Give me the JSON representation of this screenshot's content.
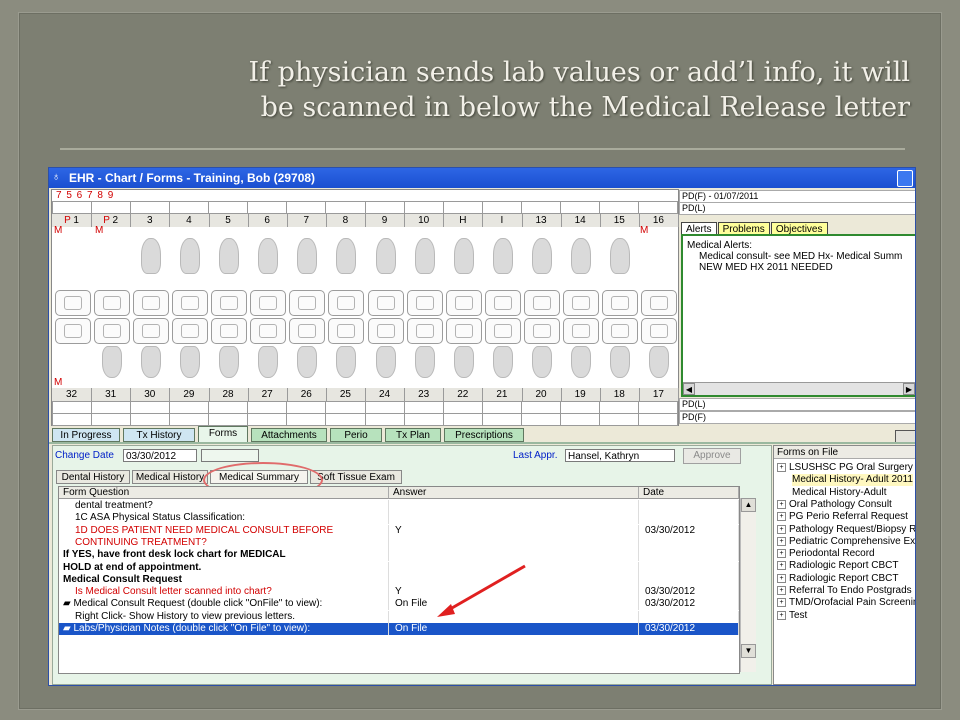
{
  "slide": {
    "title_line1": "If physician sends lab values or add’l info, it will",
    "title_line2": "be scanned in below the Medical Release letter"
  },
  "window": {
    "title": "EHR - Chart / Forms - Training, Bob (29708)",
    "chart": {
      "top_marks": "7 5 6  7 8 9",
      "upper_teeth": [
        {
          "label": "1",
          "prefix": "P"
        },
        {
          "label": "2",
          "prefix": "P"
        },
        {
          "label": "3"
        },
        {
          "label": "4"
        },
        {
          "label": "5"
        },
        {
          "label": "6"
        },
        {
          "label": "7"
        },
        {
          "label": "8"
        },
        {
          "label": "9"
        },
        {
          "label": "10"
        },
        {
          "label": "H"
        },
        {
          "label": "I"
        },
        {
          "label": "13"
        },
        {
          "label": "14"
        },
        {
          "label": "15"
        },
        {
          "label": "16"
        }
      ],
      "lower_teeth": [
        "32",
        "31",
        "30",
        "29",
        "28",
        "27",
        "26",
        "25",
        "24",
        "23",
        "22",
        "21",
        "20",
        "19",
        "18",
        "17"
      ],
      "missing_marks": [
        "M",
        "M",
        "M"
      ],
      "pd_top": [
        "PD(F) - 01/07/2011",
        "PD(L)"
      ],
      "pd_bottom": [
        "PD(L)",
        "PD(F)"
      ]
    },
    "right_tabs": [
      "Alerts",
      "Problems",
      "Objectives"
    ],
    "alerts": {
      "heading": "Medical Alerts:",
      "lines": [
        "Medical consult- see MED Hx- Medical Summ",
        "NEW MED HX 2011 NEEDED"
      ]
    },
    "main_tabs": [
      "In Progress",
      "Tx History",
      "Forms",
      "Attachments",
      "Perio",
      "Tx Plan",
      "Prescriptions"
    ],
    "forms": {
      "change_date_label": "Change Date",
      "change_date": "03/30/2012",
      "last_appr_label": "Last Appr.",
      "last_appr": "Hansel, Kathryn",
      "approve_label": "Approve",
      "sub_tabs": [
        "Dental History",
        "Medical History",
        "Medical Summary",
        "Soft Tissue Exam"
      ],
      "columns": [
        "Form Question",
        "Answer",
        "Date"
      ],
      "rows": [
        {
          "q": "dental treatment?",
          "a": "",
          "d": "",
          "style": "indent"
        },
        {
          "q": "1C ASA Physical Status Classification:",
          "a": "",
          "d": "",
          "style": "indent"
        },
        {
          "q": "1D DOES PATIENT NEED MEDICAL CONSULT BEFORE",
          "a": "Y",
          "d": "03/30/2012",
          "style": "red"
        },
        {
          "q": "CONTINUING TREATMENT?",
          "a": "",
          "d": "",
          "style": "red"
        },
        {
          "q": "If YES, have front desk lock chart for MEDICAL",
          "a": "",
          "d": "",
          "style": "bold"
        },
        {
          "q": "HOLD at end of appointment.",
          "a": "",
          "d": "",
          "style": "bold"
        },
        {
          "q": "Medical Consult Request",
          "a": "",
          "d": "",
          "style": "bold"
        },
        {
          "q": "Is Medical Consult letter scanned into chart?",
          "a": "Y",
          "d": "03/30/2012",
          "style": "red"
        },
        {
          "q": "Medical Consult Request (double click \"OnFile\" to view):",
          "a": "On File",
          "d": "03/30/2012",
          "style": "icon"
        },
        {
          "q": "Right Click- Show History to view previous letters.",
          "a": "",
          "d": "",
          "style": "indent"
        },
        {
          "q": "Labs/Physician Notes (double click \"On File\" to view):",
          "a": "On File",
          "d": "03/30/2012",
          "style": "icon-sel"
        }
      ]
    },
    "forms_on_file": {
      "heading": "Forms on File",
      "items": [
        {
          "label": "LSUSHSC PG Oral Surgery",
          "type": "expand"
        },
        {
          "label": "Medical History- Adult 2011",
          "type": "sub-hl"
        },
        {
          "label": "Medical History-Adult",
          "type": "sub"
        },
        {
          "label": "Oral Pathology Consult",
          "type": "expand"
        },
        {
          "label": "PG Perio Referral Request",
          "type": "expand"
        },
        {
          "label": "Pathology Request/Biopsy Rpt",
          "type": "expand"
        },
        {
          "label": "Pediatric Comprehensive Exam",
          "type": "expand"
        },
        {
          "label": "Periodontal Record",
          "type": "expand"
        },
        {
          "label": "Radiologic Report CBCT",
          "type": "expand"
        },
        {
          "label": "Radiologic Report CBCT",
          "type": "expand"
        },
        {
          "label": "Referral To Endo Postgrads",
          "type": "expand"
        },
        {
          "label": "TMD/Orofacial Pain Screening",
          "type": "expand"
        },
        {
          "label": "Test",
          "type": "expand"
        }
      ]
    }
  },
  "colors": {
    "selected_row": "#1a55c8",
    "alert_border": "#2f8a2f",
    "arrow": "#e02020",
    "red_text": "#d20000"
  }
}
